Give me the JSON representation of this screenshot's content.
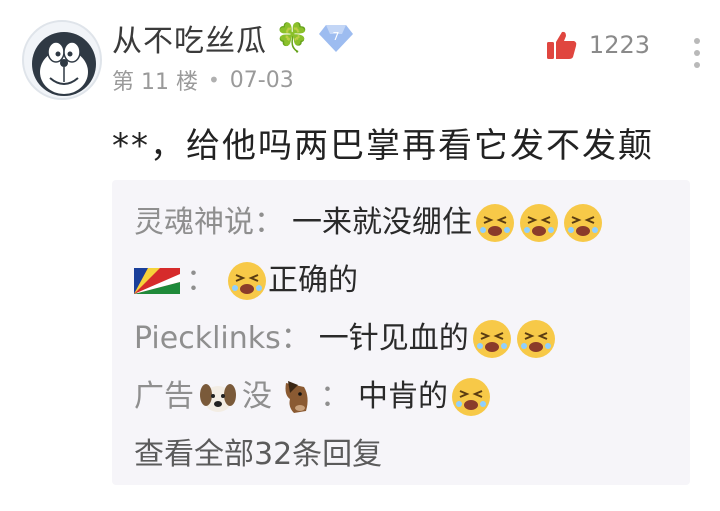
{
  "post": {
    "username": "从不吃丝瓜",
    "clover_icon": "four-leaf-clover-icon",
    "level_badge": "7",
    "floor": "第 11 楼",
    "dot": "•",
    "date": "07-03",
    "likes": "1223",
    "comment": "**，给他吗两巴掌再看它发不发颠"
  },
  "replies": [
    {
      "user": "灵魂神说",
      "colon": "：",
      "text": "一来就没绷住",
      "emojis": 3
    },
    {
      "user": "",
      "flag_icon": "flag-icon",
      "colon": "：",
      "text": "正确的",
      "emojis_before": 1
    },
    {
      "user": "Piecklinks",
      "colon": "：",
      "text": "一针见血的",
      "emojis": 2
    },
    {
      "user_a": "广告",
      "user_b": "没",
      "animal_icons": [
        "dog-face-icon",
        "horse-face-icon"
      ],
      "colon": "：",
      "text": "中肯的",
      "emojis": 1
    }
  ],
  "view_all": "查看全部32条回复",
  "colors": {
    "like_red": "#e0463f",
    "emoji_yellow": "#f7c948",
    "badge_blue": "#7fa8e8"
  }
}
